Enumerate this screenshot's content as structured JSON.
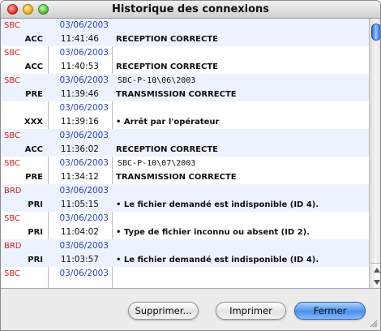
{
  "window": {
    "title": "Historique des connexions"
  },
  "entries": [
    {
      "code1": "SBC",
      "date": "03/06/2003",
      "code2": "ACC",
      "time": "11:41:46",
      "msg1": "",
      "msg2": "RECEPTION CORRECTE"
    },
    {
      "code1": "SBC",
      "date": "03/06/2003",
      "code2": "ACC",
      "time": "11:40:53",
      "msg1": "",
      "msg2": "RECEPTION CORRECTE"
    },
    {
      "code1": "SBC",
      "date": "03/06/2003",
      "code2": "PRE",
      "time": "11:39:46",
      "msg1": "SBC-P-10\\06\\2003",
      "msg2": "TRANSMISSION CORRECTE"
    },
    {
      "code1": "",
      "date": "03/06/2003",
      "code2": "XXX",
      "time": "11:39:16",
      "msg1": "",
      "msg2": "• Arrêt par l'opérateur"
    },
    {
      "code1": "SBC",
      "date": "03/06/2003",
      "code2": "ACC",
      "time": "11:36:02",
      "msg1": "",
      "msg2": "RECEPTION CORRECTE"
    },
    {
      "code1": "SBC",
      "date": "03/06/2003",
      "code2": "PRE",
      "time": "11:34:12",
      "msg1": "SBC-P-10\\07\\2003",
      "msg2": "TRANSMISSION CORRECTE"
    },
    {
      "code1": "BRD",
      "date": "03/06/2003",
      "code2": "PRI",
      "time": "11:05:15",
      "msg1": "",
      "msg2": "• Le fichier demandé est indisponible (ID 4)."
    },
    {
      "code1": "SBC",
      "date": "03/06/2003",
      "code2": "PRI",
      "time": "11:04:02",
      "msg1": "",
      "msg2": "• Type de fichier inconnu ou absent (ID 2)."
    },
    {
      "code1": "BRD",
      "date": "03/06/2003",
      "code2": "PRI",
      "time": "11:03:57",
      "msg1": "",
      "msg2": "• Le fichier demandé est indisponible (ID 4)."
    },
    {
      "code1": "SBC",
      "date": "03/06/2003",
      "code2": "",
      "time": "",
      "msg1": "",
      "msg2": ""
    }
  ],
  "buttons": {
    "delete_label": "Supprimer...",
    "print_label": "Imprimer",
    "close_label": "Fermer"
  },
  "colors": {
    "code_red": "#d0201a",
    "date_blue": "#2b45c0",
    "row_alt": "#edf3fe",
    "accent_button": "#4a8fe8"
  },
  "icons": [
    "close-window-icon",
    "minimize-window-icon",
    "zoom-window-icon",
    "scroll-up-icon",
    "scroll-down-icon",
    "resize-grip-icon"
  ]
}
